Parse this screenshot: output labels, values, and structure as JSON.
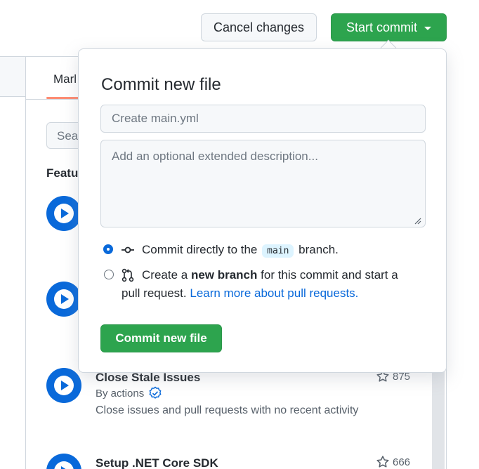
{
  "header": {
    "cancel_label": "Cancel changes",
    "start_commit_label": "Start commit"
  },
  "background": {
    "tab_label": "Marl",
    "search_placeholder": "Sea",
    "featured_label": "Featu",
    "items": [
      {
        "title": "Close Stale Issues",
        "by": "By actions",
        "description": "Close issues and pull requests with no recent activity",
        "stars": "875"
      },
      {
        "title": "Setup .NET Core SDK",
        "stars": "666"
      }
    ]
  },
  "commit_dialog": {
    "title": "Commit new file",
    "summary_placeholder": "Create main.yml",
    "description_placeholder": "Add an optional extended description...",
    "option_direct": {
      "prefix": "Commit directly to the",
      "branch": "main",
      "suffix": "branch.",
      "selected": true
    },
    "option_new_branch": {
      "prefix": "Create a",
      "bold": "new branch",
      "rest": "for this commit and start a",
      "line2": "pull request.",
      "link": "Learn more about pull requests.",
      "selected": false
    },
    "submit_label": "Commit new file"
  },
  "colors": {
    "primary_green": "#2da44e",
    "link_blue": "#0969da",
    "tab_underline": "#fd8c73"
  }
}
